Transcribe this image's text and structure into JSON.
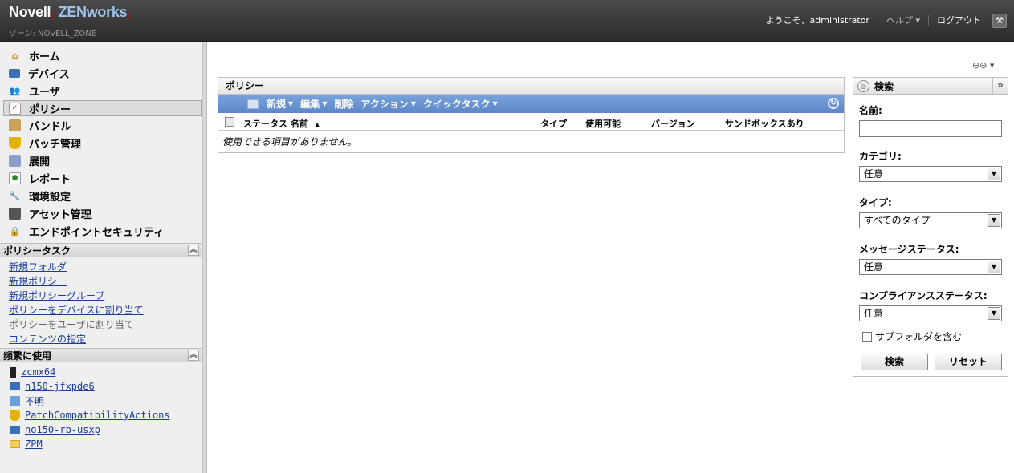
{
  "header": {
    "brand_main": "Novell",
    "brand_product": "ZENworks",
    "zone": "ゾーン: NOVELL_ZONE",
    "welcome": "ようこそ、administrator",
    "help": "ヘルプ",
    "logout": "ログアウト"
  },
  "nav": {
    "items": [
      {
        "label": "ホーム",
        "icon": "home-icon"
      },
      {
        "label": "デバイス",
        "icon": "monitor-icon"
      },
      {
        "label": "ユーザ",
        "icon": "users-icon"
      },
      {
        "label": "ポリシー",
        "icon": "policy-icon",
        "active": true
      },
      {
        "label": "バンドル",
        "icon": "bundle-icon"
      },
      {
        "label": "パッチ管理",
        "icon": "shield-icon"
      },
      {
        "label": "展開",
        "icon": "deploy-icon"
      },
      {
        "label": "レポート",
        "icon": "report-icon"
      },
      {
        "label": "環境設定",
        "icon": "wrench-icon"
      },
      {
        "label": "アセット管理",
        "icon": "asset-icon"
      },
      {
        "label": "エンドポイントセキュリティ",
        "icon": "lock-icon"
      }
    ]
  },
  "policy_tasks": {
    "title": "ポリシータスク",
    "items": [
      "新規フォルダ",
      "新規ポリシー",
      "新規ポリシーグループ",
      "ポリシーをデバイスに割り当て",
      "ポリシーをユーザに割り当て",
      "コンテンツの指定"
    ]
  },
  "frequent": {
    "title": "頻繁に使用",
    "items": [
      {
        "label": "zcmx64",
        "icon": "server-icon"
      },
      {
        "label": "n150-jfxpde6",
        "icon": "monitor-icon"
      },
      {
        "label": "不明",
        "icon": "unknown-icon"
      },
      {
        "label": "PatchCompatibilityActions",
        "icon": "shield-icon"
      },
      {
        "label": "no150-rb-usxp",
        "icon": "monitor-icon"
      },
      {
        "label": "ZPM",
        "icon": "folder-icon"
      }
    ]
  },
  "policy_panel": {
    "title": "ポリシー",
    "toolbar": {
      "new": "新規",
      "edit": "編集",
      "delete": "削除",
      "action": "アクション",
      "quick_task": "クイックタスク"
    },
    "columns": {
      "status": "ステータス",
      "name": "名前",
      "type": "タイプ",
      "enabled": "使用可能",
      "version": "バージョン",
      "sandbox": "サンドボックスあり"
    },
    "empty_text": "使用できる項目がありません。"
  },
  "search": {
    "title": "検索",
    "name_label": "名前:",
    "name_value": "",
    "category_label": "カテゴリ:",
    "category_value": "任意",
    "type_label": "タイプ:",
    "type_value": "すべてのタイプ",
    "message_status_label": "メッセージステータス:",
    "message_status_value": "任意",
    "compliance_label": "コンプライアンスステータス:",
    "compliance_value": "任意",
    "subfolder_label": "サブフォルダを含む",
    "search_button": "検索",
    "reset_button": "リセット"
  }
}
